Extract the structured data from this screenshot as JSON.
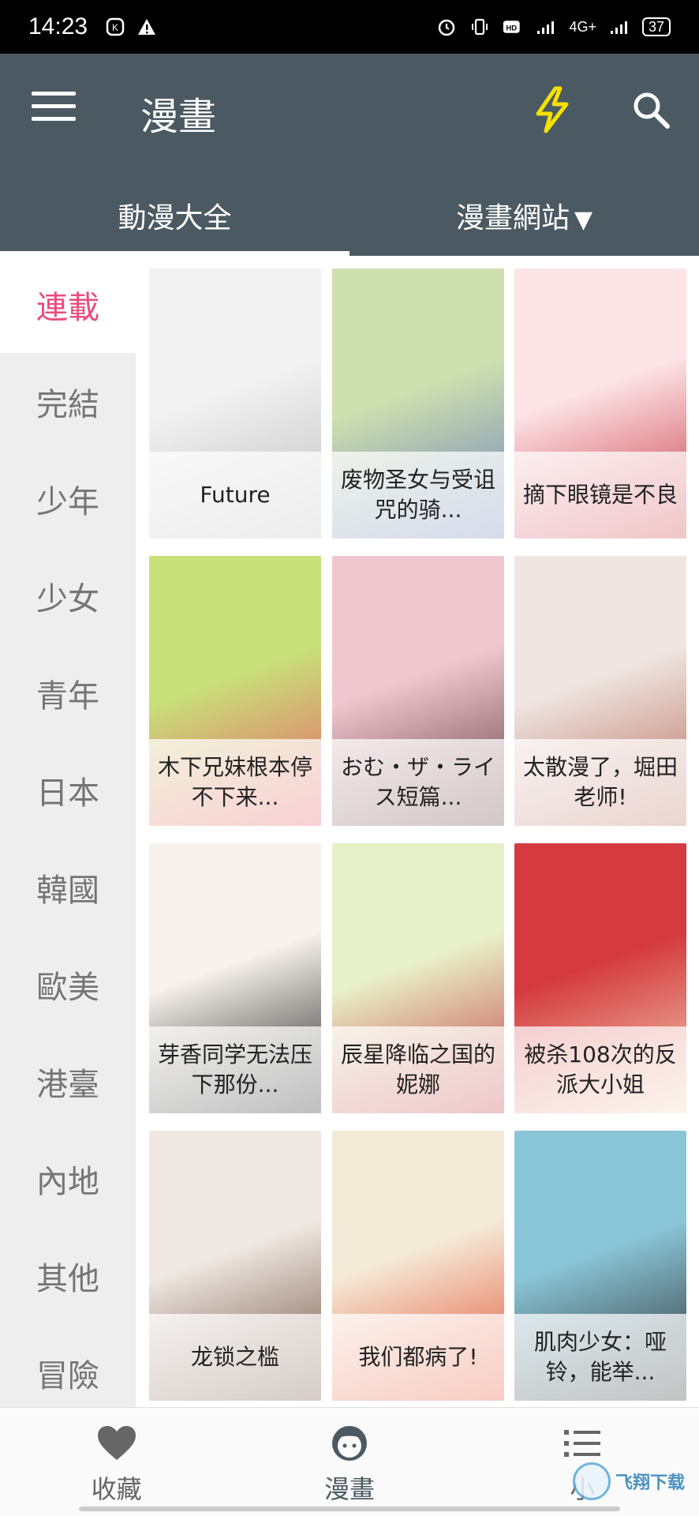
{
  "status_bar": {
    "time": "14:23",
    "network": "4G+",
    "battery": "37"
  },
  "app_bar": {
    "title": "漫畫",
    "tabs": [
      {
        "label": "動漫大全"
      },
      {
        "label": "漫畫網站",
        "caret": "▼"
      }
    ]
  },
  "sidebar": {
    "items": [
      {
        "label": "連載"
      },
      {
        "label": "完結"
      },
      {
        "label": "少年"
      },
      {
        "label": "少女"
      },
      {
        "label": "青年"
      },
      {
        "label": "日本"
      },
      {
        "label": "韓國"
      },
      {
        "label": "歐美"
      },
      {
        "label": "港臺"
      },
      {
        "label": "內地"
      },
      {
        "label": "其他"
      },
      {
        "label": "冒險"
      }
    ]
  },
  "comics": [
    {
      "title": "Future",
      "colors": [
        "#f2f2f2",
        "#bdbdbd"
      ]
    },
    {
      "title": "废物圣女与受诅咒的骑...",
      "colors": [
        "#cfe0b0",
        "#6b7fb8"
      ]
    },
    {
      "title": "摘下眼镜是不良",
      "colors": [
        "#fbe3e6",
        "#c9333f"
      ]
    },
    {
      "title": "木下兄妹根本停不下来...",
      "colors": [
        "#c8e07a",
        "#e85a68"
      ]
    },
    {
      "title": "おむ・ザ・ライス短篇...",
      "colors": [
        "#f1c7cf",
        "#5c3a3a"
      ]
    },
    {
      "title": "太散漫了，堀田老师!",
      "colors": [
        "#efe6e2",
        "#b56a5a"
      ]
    },
    {
      "title": "芽香同学无法压下那份...",
      "colors": [
        "#f7f2ec",
        "#1c1c1c"
      ]
    },
    {
      "title": "辰星降临之国的妮娜",
      "colors": [
        "#e8f0c9",
        "#c03b3b"
      ]
    },
    {
      "title": "被杀108次的反派大小姐",
      "colors": [
        "#d43a40",
        "#f2d7b6"
      ]
    },
    {
      "title": "龙锁之槛",
      "colors": [
        "#efe8e2",
        "#6a4a3a"
      ]
    },
    {
      "title": "我们都病了!",
      "colors": [
        "#f4ead8",
        "#e24b2b"
      ]
    },
    {
      "title": "肌肉少女：哑铃，能举...",
      "colors": [
        "#8bc6d8",
        "#2b2b2b"
      ]
    }
  ],
  "bottom_nav": {
    "items": [
      {
        "label": "收藏"
      },
      {
        "label": "漫畫"
      },
      {
        "label": "小"
      }
    ]
  },
  "watermark": {
    "text": "飞翔下载"
  }
}
